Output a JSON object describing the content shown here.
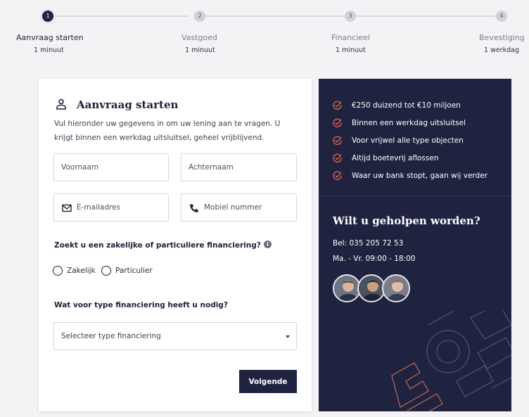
{
  "stepper": {
    "steps": [
      {
        "number": "1",
        "title": "Aanvraag starten",
        "duration": "1 minuut"
      },
      {
        "number": "2",
        "title": "Vastgoed",
        "duration": "1 minuut"
      },
      {
        "number": "3",
        "title": "Financieel",
        "duration": "1 minuut"
      },
      {
        "number": "4",
        "title": "Bevestiging",
        "duration": "1 werkdag"
      }
    ]
  },
  "form": {
    "title": "Aanvraag starten",
    "intro": "Vul hieronder uw gegevens in om uw lening aan te vragen. U krijgt binnen een werkdag uitsluitsel, geheel vrijblijvend.",
    "first_name_placeholder": "Voornaam",
    "last_name_placeholder": "Achternaam",
    "email_placeholder": "E-mailadres",
    "phone_placeholder": "Mobiel nummer",
    "financing_question": "Zoekt u een zakelijke of particuliere financiering?",
    "info_glyph": "i",
    "option_business": "Zakelijk",
    "option_private": "Particulier",
    "type_question": "Wat voor type financiering heeft u nodig?",
    "type_select_value": "Selecteer type financiering",
    "next_label": "Volgende"
  },
  "panel": {
    "usps": [
      "€250 duizend tot €10 miljoen",
      "Binnen een werkdag uitsluitsel",
      "Voor vrijwel alle type objecten",
      "Altijd boetevrij aflossen",
      "Waar uw bank stopt, gaan wij verder"
    ],
    "help_title": "Wilt u geholpen worden?",
    "phone": "Bel: 035 205 72 53",
    "hours": "Ma. - Vr. 09:00 - 18:00"
  },
  "colors": {
    "navy": "#1f2340",
    "accent": "#e8664a",
    "background": "#f3f3f5"
  },
  "icons": [
    "person-icon",
    "mail-icon",
    "phone-icon",
    "info-icon",
    "check-circle-icon",
    "chevron-down-icon"
  ]
}
